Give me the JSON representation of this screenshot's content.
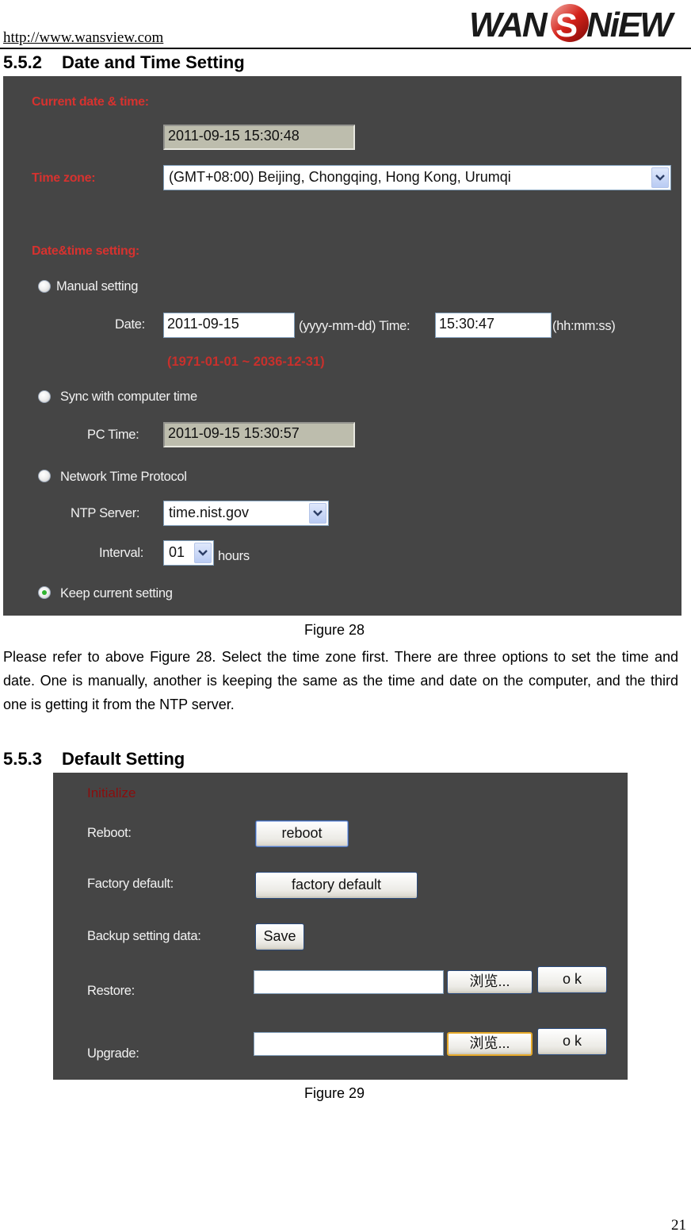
{
  "header": {
    "url": "http://www.wansview.com",
    "logo_text": "WANSVIEW",
    "logo_icon": "wansview-logo"
  },
  "section_552": {
    "number": "5.5.2",
    "title": "Date and Time Setting"
  },
  "figure28": {
    "current_label": "Current date & time:",
    "current_value": "2011-09-15 15:30:48",
    "timezone_label": "Time zone:",
    "timezone_value": "(GMT+08:00) Beijing, Chongqing, Hong Kong, Urumqi",
    "setting_label": "Date&time setting:",
    "manual": {
      "label": "Manual setting",
      "selected": false,
      "date_label": "Date:",
      "date_value": "2011-09-15",
      "date_hint": "(yyyy-mm-dd) Time:",
      "time_value": "15:30:47",
      "time_hint": "(hh:mm:ss)",
      "range": "(1971-01-01 ~ 2036-12-31)"
    },
    "sync": {
      "label": "Sync with computer time",
      "selected": false,
      "pc_time_label": "PC Time:",
      "pc_time_value": "2011-09-15 15:30:57"
    },
    "ntp": {
      "label": "Network Time Protocol",
      "selected": false,
      "server_label": "NTP Server:",
      "server_value": "time.nist.gov",
      "interval_label": "Interval:",
      "interval_value": "01",
      "interval_unit": "hours"
    },
    "keep": {
      "label": "Keep current setting",
      "selected": true
    },
    "caption": "Figure 28"
  },
  "paragraph": "Please refer to above Figure 28. Select the time zone first. There are three options to set the time and date. One is manually, another is keeping the same as the time and date on the computer, and the third one is getting it from the NTP server.",
  "section_553": {
    "number": "5.5.3",
    "title": "Default Setting"
  },
  "figure29": {
    "heading": "Initialize",
    "reboot_label": "Reboot:",
    "reboot_button": "reboot",
    "factory_label": "Factory default:",
    "factory_button": "factory default",
    "backup_label": "Backup setting data:",
    "backup_button": "Save",
    "restore_label": "Restore:",
    "restore_file_value": "",
    "restore_browse": "浏览...",
    "restore_ok": "o k",
    "upgrade_label": "Upgrade:",
    "upgrade_file_value": "",
    "upgrade_browse": "浏览...",
    "upgrade_ok": "o k",
    "caption": "Figure 29"
  },
  "page_number": "21",
  "colors": {
    "panel_bg": "#454545",
    "label_red": "#d6322f",
    "heading_dark_red": "#8b0d0d",
    "readonly_field": "#bdbdad",
    "radio_selected": "#2fb42f"
  }
}
